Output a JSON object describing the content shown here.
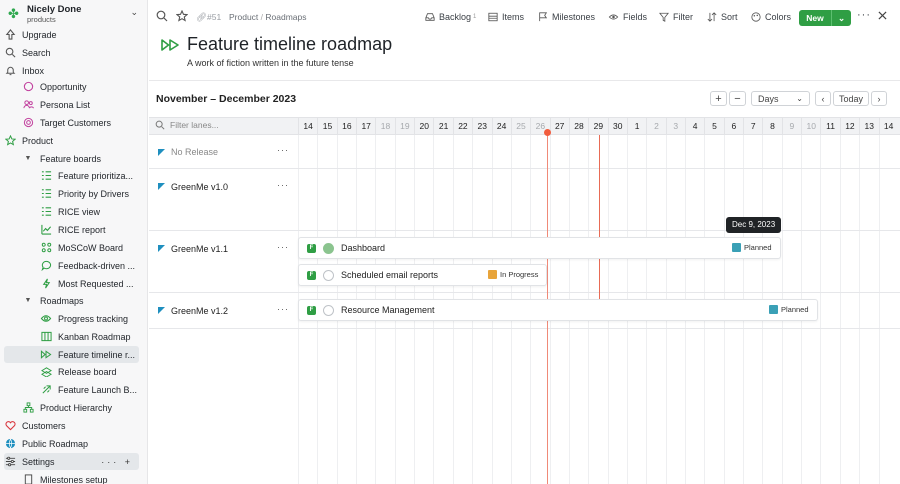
{
  "workspace": {
    "name": "Nicely Done",
    "subtitle": "products"
  },
  "nav": {
    "upgrade": "Upgrade",
    "search": "Search",
    "inbox": "Inbox"
  },
  "sidebar": {
    "items": [
      {
        "label": "Opportunity",
        "icon": "opportunity-icon"
      },
      {
        "label": "Persona List",
        "icon": "persona-icon"
      },
      {
        "label": "Target Customers",
        "icon": "target-icon"
      },
      {
        "label": "Product",
        "icon": "star-icon"
      },
      {
        "label": "Feature boards",
        "icon": "caret-down-icon"
      },
      {
        "label": "Feature prioritiza...",
        "icon": "list-icon"
      },
      {
        "label": "Priority by Drivers",
        "icon": "list-icon"
      },
      {
        "label": "RICE view",
        "icon": "list-icon"
      },
      {
        "label": "RICE report",
        "icon": "chart-icon"
      },
      {
        "label": "MoSCoW Board",
        "icon": "board-icon"
      },
      {
        "label": "Feedback-driven ...",
        "icon": "feedback-icon"
      },
      {
        "label": "Most Requested ...",
        "icon": "requested-icon"
      },
      {
        "label": "Roadmaps",
        "icon": "caret-down-icon"
      },
      {
        "label": "Progress tracking",
        "icon": "eye-icon"
      },
      {
        "label": "Kanban Roadmap",
        "icon": "kanban-icon"
      },
      {
        "label": "Feature timeline r...",
        "icon": "timeline-icon"
      },
      {
        "label": "Release board",
        "icon": "release-icon"
      },
      {
        "label": "Feature Launch B...",
        "icon": "launch-icon"
      },
      {
        "label": "Product Hierarchy",
        "icon": "hierarchy-icon"
      },
      {
        "label": "Customers",
        "icon": "heart-icon"
      },
      {
        "label": "Public Roadmap",
        "icon": "globe-icon"
      },
      {
        "label": "Settings",
        "icon": "settings-icon"
      },
      {
        "label": "Milestones setup",
        "icon": "doc-icon"
      }
    ]
  },
  "topbar": {
    "hash": "#51",
    "breadcrumb": [
      "Product",
      "Roadmaps"
    ],
    "backlog": "Backlog",
    "backlog_count": "1",
    "items": "Items",
    "milestones": "Milestones",
    "fields": "Fields",
    "filter": "Filter",
    "sort": "Sort",
    "colors": "Colors",
    "new": "New"
  },
  "page": {
    "title": "Feature timeline roadmap",
    "subtitle": "A work of fiction written in the future tense"
  },
  "timeline": {
    "range": "November – December 2023",
    "zoom": "Days",
    "today": "Today",
    "filter_placeholder": "Filter lanes...",
    "days": [
      "14",
      "15",
      "16",
      "17",
      "18",
      "19",
      "20",
      "21",
      "22",
      "23",
      "24",
      "25",
      "26",
      "27",
      "28",
      "29",
      "30",
      "1",
      "2",
      "3",
      "4",
      "5",
      "6",
      "7",
      "8",
      "9",
      "10",
      "11",
      "12",
      "13",
      "14"
    ],
    "tooltip": "Dec 9, 2023"
  },
  "lanes": [
    {
      "name": "No Release",
      "dim": true
    },
    {
      "name": "GreenMe v1.0"
    },
    {
      "name": "GreenMe v1.1"
    },
    {
      "name": "GreenMe v1.2"
    }
  ],
  "cards": [
    {
      "badge": "F",
      "name": "Dashboard",
      "status": "Planned",
      "status_color": "#3aa0b6"
    },
    {
      "badge": "F",
      "name": "Scheduled email reports",
      "status": "In Progress",
      "status_color": "#e8a43a"
    },
    {
      "badge": "F",
      "name": "Resource Management",
      "status": "Planned",
      "status_color": "#3aa0b6"
    }
  ],
  "colors": {
    "accent": "#2f9e44",
    "today_line": "#f25c3d"
  }
}
